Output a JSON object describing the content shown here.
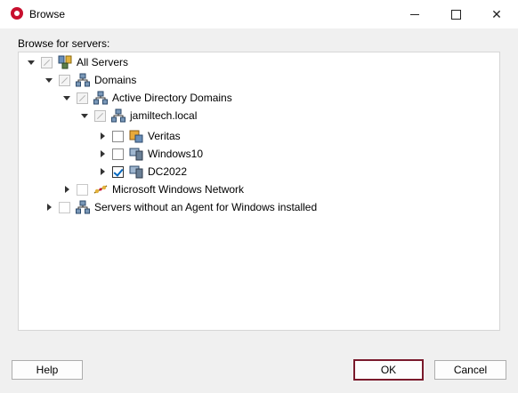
{
  "window": {
    "title": "Browse"
  },
  "browse_label": "Browse for servers:",
  "tree": {
    "all_servers": "All Servers",
    "domains": "Domains",
    "active_directory_domains": "Active Directory Domains",
    "domain_local": "jamiltech.local",
    "servers": [
      {
        "label": "Veritas",
        "checked": false
      },
      {
        "label": "Windows10",
        "checked": false
      },
      {
        "label": "DC2022",
        "checked": true
      }
    ],
    "microsoft_windows_network": "Microsoft Windows Network",
    "servers_without_agent": "Servers without an Agent for Windows installed"
  },
  "buttons": {
    "help": "Help",
    "ok": "OK",
    "cancel": "Cancel"
  },
  "colors": {
    "brand": "#c8102e",
    "ok_border": "#7a1a2c",
    "check": "#0067c0"
  }
}
